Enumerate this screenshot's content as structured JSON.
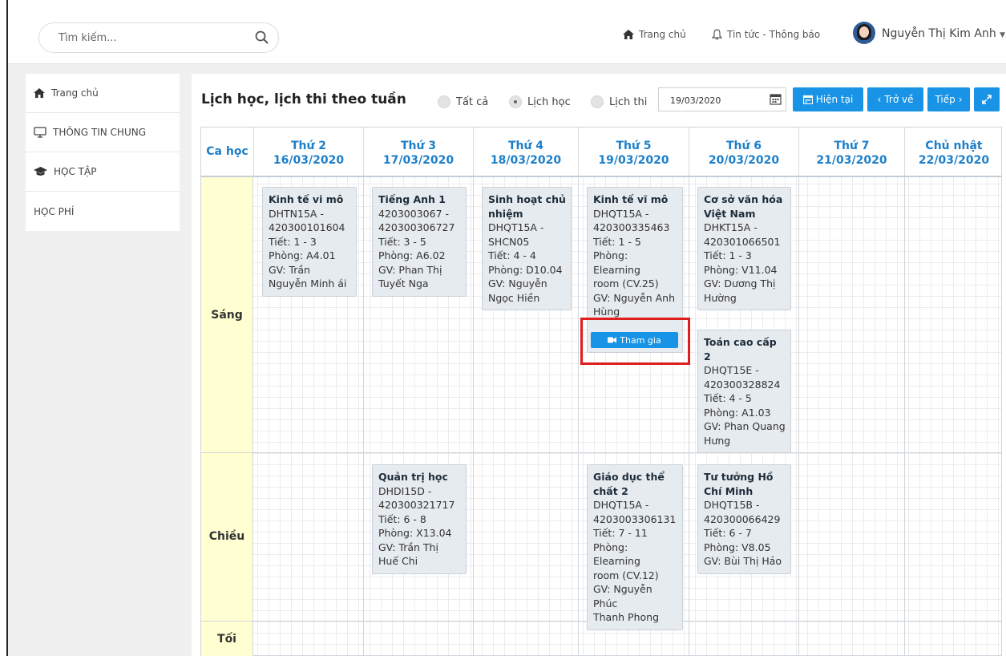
{
  "header": {
    "search_placeholder": "Tìm kiếm...",
    "home_link": "Trang chủ",
    "news_link": "Tin tức - Thông báo",
    "user_name": "Nguyễn Thị Kim Anh"
  },
  "sidebar": {
    "items": [
      {
        "label": "Trang chủ",
        "icon": "home-icon"
      },
      {
        "label": "THÔNG TIN CHUNG",
        "icon": "monitor-icon"
      },
      {
        "label": "HỌC TẬP",
        "icon": "graduation-cap-icon"
      },
      {
        "label": "HỌC PHÍ",
        "icon": ""
      }
    ]
  },
  "schedule": {
    "title": "Lịch học, lịch thi theo tuần",
    "filters": [
      {
        "label": "Tất cả",
        "selected": false
      },
      {
        "label": "Lịch học",
        "selected": true
      },
      {
        "label": "Lịch thi",
        "selected": false
      }
    ],
    "date_value": "19/03/2020",
    "buttons": {
      "current": "Hiện tại",
      "back": "Trở về",
      "next": "Tiếp"
    },
    "ca_hoc_label": "Ca học",
    "days": [
      {
        "name": "Thứ 2",
        "date": "16/03/2020"
      },
      {
        "name": "Thứ 3",
        "date": "17/03/2020"
      },
      {
        "name": "Thứ 4",
        "date": "18/03/2020"
      },
      {
        "name": "Thứ 5",
        "date": "19/03/2020"
      },
      {
        "name": "Thứ 6",
        "date": "20/03/2020"
      },
      {
        "name": "Thứ 7",
        "date": "21/03/2020"
      },
      {
        "name": "Chủ nhật",
        "date": "22/03/2020"
      }
    ],
    "sessions": {
      "morning": "Sáng",
      "afternoon": "Chiều",
      "evening": "Tối"
    },
    "join_label": "Tham gia",
    "classes": [
      {
        "name": "Kinh tế vi mô",
        "lines": [
          "DHTN15A -",
          "420300101604",
          "Tiết: 1 - 3",
          "Phòng: A4.01",
          "GV: Trần",
          "Nguyễn Minh ái"
        ]
      },
      {
        "name": "Tiếng Anh 1",
        "lines": [
          "4203003067 -",
          "420300306727",
          "Tiết: 3 - 5",
          "Phòng: A6.02",
          "GV: Phan Thị",
          "Tuyết Nga"
        ]
      },
      {
        "name": "Sinh hoạt chủ nhiệm",
        "lines": [
          "DHQT15A -",
          "SHCN05",
          "Tiết: 4 - 4",
          "Phòng: D10.04",
          "GV: Nguyễn",
          "Ngọc Hiền"
        ]
      },
      {
        "name": "Kinh tế vĩ mô",
        "lines": [
          "DHQT15A -",
          "420300335463",
          "Tiết: 1 - 5",
          "Phòng: Elearning",
          "room (CV.25)",
          "GV: Nguyễn Anh",
          "Hùng"
        ]
      },
      {
        "name": "Cơ sở văn hóa Việt Nam",
        "lines": [
          "DHKT15A -",
          "420301066501",
          "Tiết: 1 - 3",
          "Phòng: V11.04",
          "GV: Dương Thị",
          "Hường"
        ]
      },
      {
        "name": "Toán cao cấp 2",
        "lines": [
          "DHQT15E -",
          "420300328824",
          "Tiết: 4 - 5",
          "Phòng: A1.03",
          "GV: Phan Quang",
          "Hưng"
        ]
      },
      {
        "name": "Quản trị học",
        "lines": [
          "DHDI15D -",
          "420300321717",
          "Tiết: 6 - 8",
          "Phòng: X13.04",
          "GV: Trần Thị",
          "Huế Chi"
        ]
      },
      {
        "name": "Giáo dục thể chất 2",
        "lines": [
          "DHQT15A -",
          "4203003306131",
          "Tiết: 7 - 11",
          "Phòng: Elearning",
          "room (CV.12)",
          "GV: Nguyễn Phúc",
          "Thanh Phong"
        ]
      },
      {
        "name": "Tư tưởng Hồ Chí Minh",
        "lines": [
          "DHQT15B -",
          "420300066429",
          "Tiết: 6 - 7",
          "Phòng: V8.05",
          "GV: Bùi Thị Hảo"
        ]
      }
    ]
  },
  "colors": {
    "accent": "#1893e6",
    "header_text": "#1d7fc9",
    "session_bg": "#ffffd2",
    "card_bg": "#e6ebef",
    "highlight": "#e01e1e"
  }
}
